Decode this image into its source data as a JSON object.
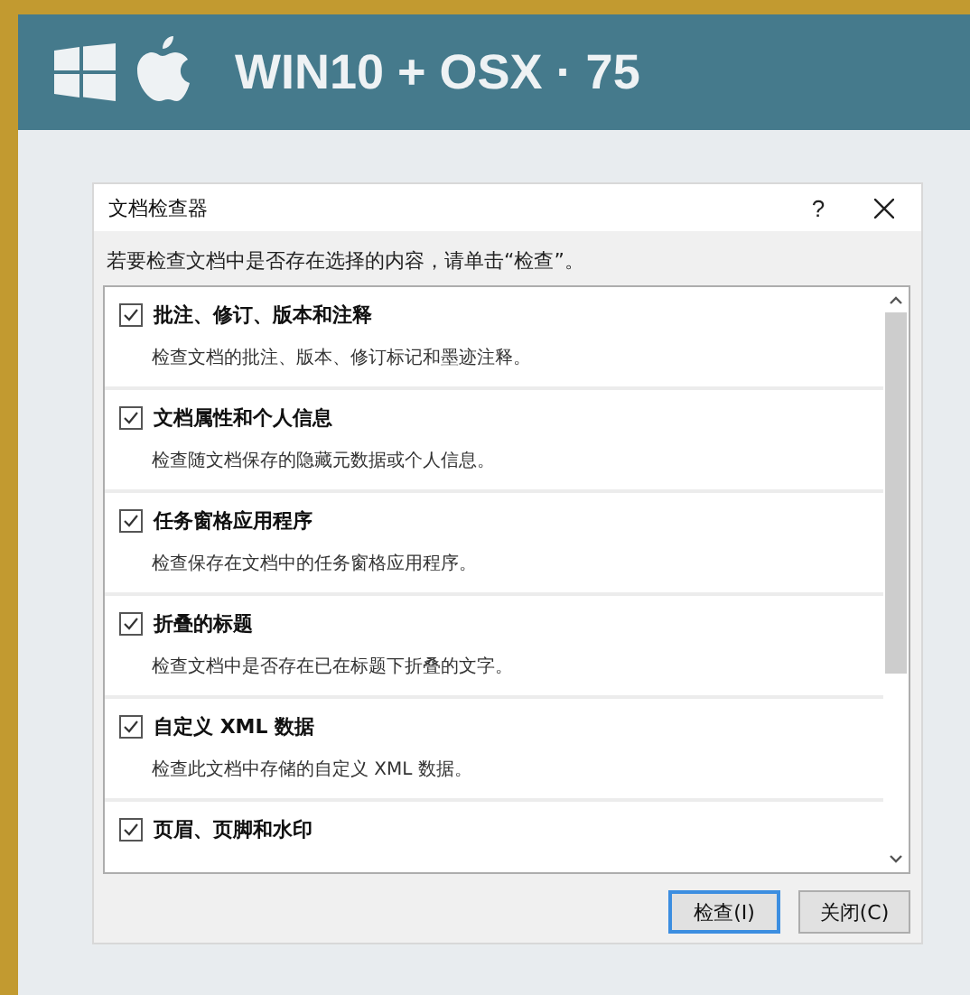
{
  "header": {
    "title": "WIN10 + OSX · 75"
  },
  "dialog": {
    "title": "文档检查器",
    "help": "?",
    "instruction": "若要检查文档中是否存在选择的内容，请单击“检查”。",
    "items": [
      {
        "title": "批注、修订、版本和注释",
        "description": "检查文档的批注、版本、修订标记和墨迹注释。",
        "checked": true
      },
      {
        "title": "文档属性和个人信息",
        "description": "检查随文档保存的隐藏元数据或个人信息。",
        "checked": true
      },
      {
        "title": "任务窗格应用程序",
        "description": "检查保存在文档中的任务窗格应用程序。",
        "checked": true
      },
      {
        "title": "折叠的标题",
        "description": "检查文档中是否存在已在标题下折叠的文字。",
        "checked": true
      },
      {
        "title": "自定义 XML 数据",
        "description": "检查此文档中存储的自定义 XML 数据。",
        "checked": true
      },
      {
        "title": "页眉、页脚和水印",
        "checked": true
      }
    ],
    "buttons": [
      {
        "label": "检查(I)",
        "primary": true
      },
      {
        "label": "关闭(C)",
        "primary": false
      }
    ]
  }
}
